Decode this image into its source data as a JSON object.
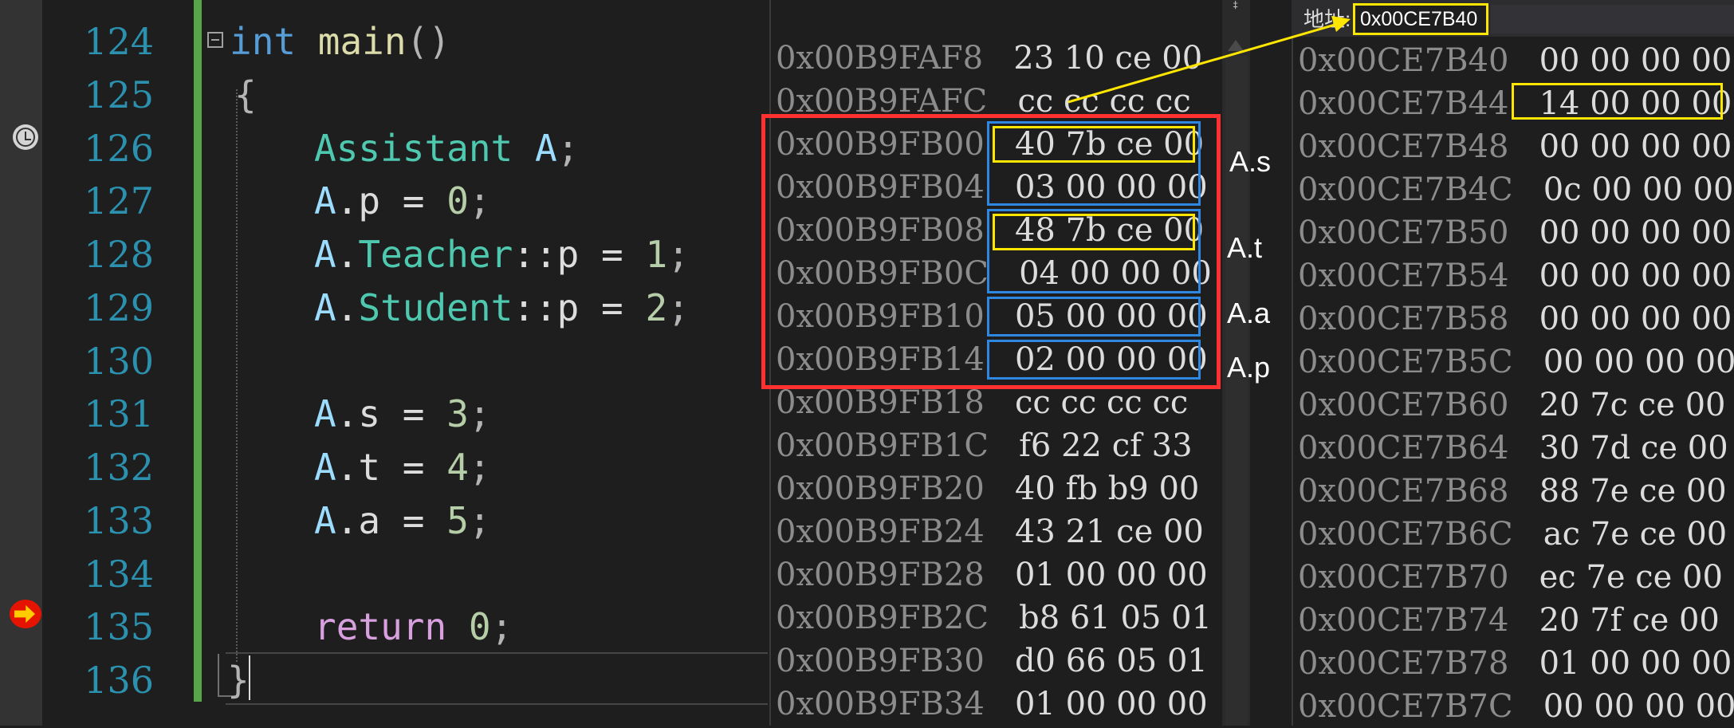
{
  "editor": {
    "line_numbers": [
      "124",
      "125",
      "126",
      "127",
      "128",
      "129",
      "130",
      "131",
      "132",
      "133",
      "134",
      "135",
      "136"
    ],
    "code": {
      "l124": {
        "kw": "int",
        "fn": "main",
        "rest": "()"
      },
      "l125": {
        "brace": "{"
      },
      "l126": {
        "type": "Assistant",
        "var": "A",
        "rest": ";"
      },
      "l127": {
        "var": "A",
        "member": ".p = ",
        "num": "0",
        "rest": ";"
      },
      "l128": {
        "var": "A",
        "dot": ".",
        "type": "Teacher",
        "member": "::p = ",
        "num": "1",
        "rest": ";"
      },
      "l129": {
        "var": "A",
        "dot": ".",
        "type": "Student",
        "member": "::p = ",
        "num": "2",
        "rest": ";"
      },
      "l131": {
        "var": "A",
        "member": ".s = ",
        "num": "3",
        "rest": ";"
      },
      "l132": {
        "var": "A",
        "member": ".t = ",
        "num": "4",
        "rest": ";"
      },
      "l133": {
        "var": "A",
        "member": ".a = ",
        "num": "5",
        "rest": ";"
      },
      "l135": {
        "kw": "return",
        "num": "0",
        "rest": ";"
      },
      "l136": {
        "brace": "}"
      }
    }
  },
  "memory1": {
    "rows": [
      {
        "addr": "0x00B9FAF8",
        "bytes": "23 10 ce 00"
      },
      {
        "addr": "0x00B9FAFC",
        "bytes": "cc cc cc cc"
      },
      {
        "addr": "0x00B9FB00",
        "bytes": "40 7b ce 00"
      },
      {
        "addr": "0x00B9FB04",
        "bytes": "03 00 00 00"
      },
      {
        "addr": "0x00B9FB08",
        "bytes": "48 7b ce 00"
      },
      {
        "addr": "0x00B9FB0C",
        "bytes": "04 00 00 00"
      },
      {
        "addr": "0x00B9FB10",
        "bytes": "05 00 00 00"
      },
      {
        "addr": "0x00B9FB14",
        "bytes": "02 00 00 00"
      },
      {
        "addr": "0x00B9FB18",
        "bytes": "cc cc cc cc"
      },
      {
        "addr": "0x00B9FB1C",
        "bytes": "f6 22 cf 33"
      },
      {
        "addr": "0x00B9FB20",
        "bytes": "40 fb b9 00"
      },
      {
        "addr": "0x00B9FB24",
        "bytes": "43 21 ce 00"
      },
      {
        "addr": "0x00B9FB28",
        "bytes": "01 00 00 00"
      },
      {
        "addr": "0x00B9FB2C",
        "bytes": "b8 61 05 01"
      },
      {
        "addr": "0x00B9FB30",
        "bytes": "d0 66 05 01"
      },
      {
        "addr": "0x00B9FB34",
        "bytes": "01 00 00 00"
      }
    ]
  },
  "annotations": {
    "labels": {
      "s": "A.s",
      "t": "A.t",
      "a": "A.a",
      "p": "A.p"
    },
    "colors": {
      "red": "#ff3030",
      "blue": "#2e87e0",
      "yellow": "#ffe600"
    }
  },
  "memory2": {
    "address_label": "地址:",
    "address_value": "0x00CE7B40",
    "rows": [
      {
        "addr": "0x00CE7B40",
        "bytes": "00 00 00 00"
      },
      {
        "addr": "0x00CE7B44",
        "bytes": "14 00 00 00"
      },
      {
        "addr": "0x00CE7B48",
        "bytes": "00 00 00 00"
      },
      {
        "addr": "0x00CE7B4C",
        "bytes": "0c 00 00 00"
      },
      {
        "addr": "0x00CE7B50",
        "bytes": "00 00 00 00"
      },
      {
        "addr": "0x00CE7B54",
        "bytes": "00 00 00 00"
      },
      {
        "addr": "0x00CE7B58",
        "bytes": "00 00 00 00"
      },
      {
        "addr": "0x00CE7B5C",
        "bytes": "00 00 00 00"
      },
      {
        "addr": "0x00CE7B60",
        "bytes": "20 7c ce 00"
      },
      {
        "addr": "0x00CE7B64",
        "bytes": "30 7d ce 00"
      },
      {
        "addr": "0x00CE7B68",
        "bytes": "88 7e ce 00"
      },
      {
        "addr": "0x00CE7B6C",
        "bytes": "ac 7e ce 00"
      },
      {
        "addr": "0x00CE7B70",
        "bytes": "ec 7e ce 00"
      },
      {
        "addr": "0x00CE7B74",
        "bytes": "20 7f ce 00"
      },
      {
        "addr": "0x00CE7B78",
        "bytes": "01 00 00 00"
      },
      {
        "addr": "0x00CE7B7C",
        "bytes": "00 00 00 00"
      }
    ]
  },
  "icons": {
    "timer": "clock-icon",
    "current_statement": "breakpoint-arrow-icon",
    "collapse": "collapse-icon",
    "overflow": "overflow-icon"
  }
}
